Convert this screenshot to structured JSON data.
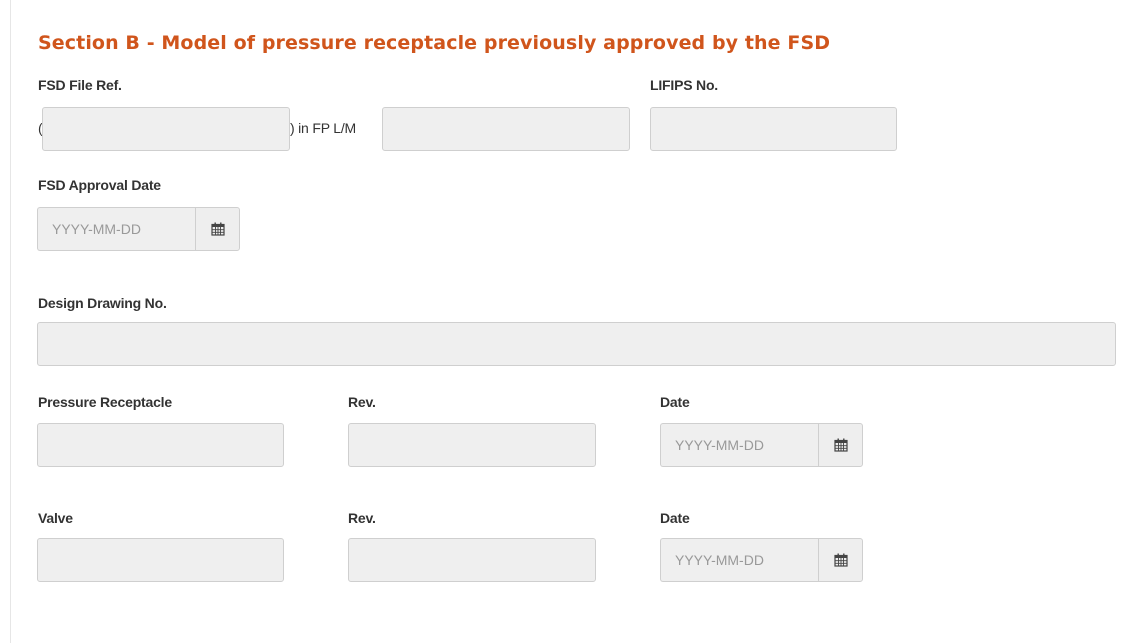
{
  "section": {
    "title": "Section B - Model of pressure receptacle previously approved by the FSD"
  },
  "fsd_file_ref": {
    "label": "FSD File Ref.",
    "open_paren": "(",
    "mid_text": ") in FP L/M",
    "part1_value": "",
    "part2_value": ""
  },
  "lifips": {
    "label": "LIFIPS No.",
    "value": ""
  },
  "fsd_approval_date": {
    "label": "FSD Approval Date",
    "placeholder": "YYYY-MM-DD",
    "icon": "calendar-icon"
  },
  "design_drawing": {
    "label": "Design Drawing No.",
    "value": ""
  },
  "pressure_receptacle": {
    "label": "Pressure Receptacle",
    "value": "",
    "rev_label": "Rev.",
    "rev_value": "",
    "date_label": "Date",
    "date_placeholder": "YYYY-MM-DD"
  },
  "valve": {
    "label": "Valve",
    "value": "",
    "rev_label": "Rev.",
    "rev_value": "",
    "date_label": "Date",
    "date_placeholder": "YYYY-MM-DD"
  },
  "colors": {
    "accent": "#d0551c",
    "field_bg": "#efefef",
    "field_border": "#cfcfcf"
  }
}
